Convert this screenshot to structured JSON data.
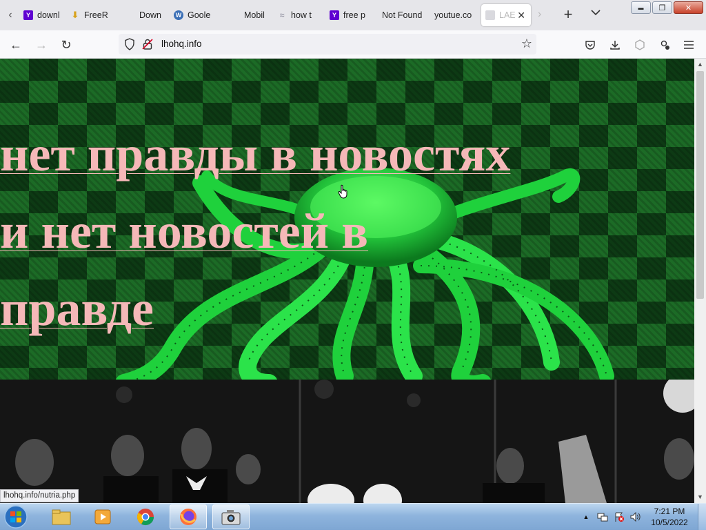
{
  "browser": {
    "tabs": [
      {
        "label": "downl",
        "favicon_color": "#5f01d1",
        "favicon_char": "Y"
      },
      {
        "label": "FreeR",
        "favicon_color": "#d8a21c",
        "favicon_char": "↓"
      },
      {
        "label": "Down",
        "favicon_color": "",
        "favicon_char": ""
      },
      {
        "label": "Goole",
        "favicon_color": "#3b6fb6",
        "favicon_char": "W"
      },
      {
        "label": "Mobil",
        "favicon_color": "",
        "favicon_char": ""
      },
      {
        "label": "how t",
        "favicon_color": "#9a9aa8",
        "favicon_char": "~"
      },
      {
        "label": "free p",
        "favicon_color": "#5f01d1",
        "favicon_char": "Y"
      },
      {
        "label": "Not Found",
        "favicon_color": "",
        "favicon_char": ""
      },
      {
        "label": "youtue.co",
        "favicon_color": "",
        "favicon_char": ""
      },
      {
        "label": "LAE",
        "favicon_color": "#cccccc",
        "favicon_char": "",
        "active": true
      }
    ],
    "active_tab_close": "✕",
    "new_tab": "+",
    "tab_list": "⌄",
    "window_controls": {
      "minimize": "▬",
      "maximize": "❐",
      "close": "✕"
    }
  },
  "navbar": {
    "back": "←",
    "forward": "→",
    "reload": "↻",
    "url": "lhohq.info",
    "bookmark": "☆"
  },
  "page": {
    "headline_lines": [
      "нет правды в новостях",
      "и нет новостей в",
      "правде"
    ],
    "hover_link": "lhohq.info/nutria.php"
  },
  "taskbar": {
    "clock_time": "7:21 PM",
    "clock_date": "10/5/2022"
  }
}
